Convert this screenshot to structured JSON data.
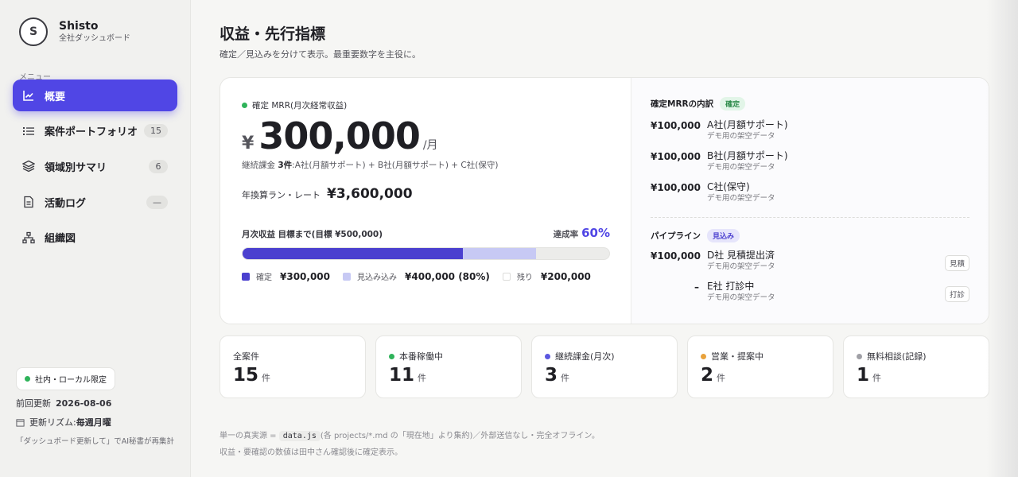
{
  "brand": {
    "name": "Shisto",
    "subtitle": "全社ダッシュボード",
    "logo_glyph": "S"
  },
  "sidebar": {
    "menu_label": "メニュー",
    "items": [
      {
        "label": "概要",
        "badge": "",
        "icon": "chart-line-icon",
        "active": true
      },
      {
        "label": "案件ポートフォリオ",
        "badge": "15",
        "icon": "list-icon"
      },
      {
        "label": "領域別サマリ",
        "badge": "6",
        "icon": "layers-icon"
      },
      {
        "label": "活動ログ",
        "badge": "—",
        "icon": "document-icon"
      },
      {
        "label": "組織図",
        "badge": "",
        "icon": "org-chart-icon"
      }
    ],
    "local_chip": "社内・ローカル限定",
    "last_updated_label": "前回更新",
    "last_updated_value": "2026-08-06",
    "rhythm_label": "更新リズム:",
    "rhythm_value": "毎週月曜",
    "note": "「ダッシュボード更新して」でAI秘書が再集計"
  },
  "header": {
    "title": "収益・先行指標",
    "subtitle": "確定／見込みを分けて表示。最重要数字を主役に。"
  },
  "mrr": {
    "label": "確定 MRR(月次経常収益)",
    "currency": "¥",
    "value": "300,000",
    "unit": "/月",
    "desc_prefix": "継続課金 ",
    "desc_count": "3件",
    "desc_suffix": ":A社(月額サポート) + B社(月額サポート) + C社(保守)",
    "runrate_label": "年換算ラン・レート",
    "runrate_value": "¥3,600,000",
    "goal_label": "月次収益 目標まで(目標 ¥500,000)",
    "achv_label": "達成率",
    "achv_value": "60%",
    "progress": {
      "confirmed_pct": 60,
      "pending_pct": 80
    },
    "legend": [
      {
        "label": "確定",
        "value": "¥300,000",
        "color": "#4b40cf"
      },
      {
        "label": "見込み込み",
        "value": "¥400,000 (80%)",
        "color": "#c7c9f4"
      },
      {
        "label": "残り",
        "value": "¥200,000",
        "color": "#ffffff"
      }
    ]
  },
  "breakdown": {
    "title": "確定MRRの内訳",
    "tag": "確定",
    "items": [
      {
        "amount": "¥100,000",
        "name": "A社(月額サポート)",
        "sub": "デモ用の架空データ"
      },
      {
        "amount": "¥100,000",
        "name": "B社(月額サポート)",
        "sub": "デモ用の架空データ"
      },
      {
        "amount": "¥100,000",
        "name": "C社(保守)",
        "sub": "デモ用の架空データ"
      }
    ]
  },
  "pipeline": {
    "title": "パイプライン",
    "tag": "見込み",
    "items": [
      {
        "amount": "¥100,000",
        "name": "D社 見積提出済",
        "sub": "デモ用の架空データ",
        "chip": "見積"
      },
      {
        "amount": "–",
        "name": "E社 打診中",
        "sub": "デモ用の架空データ",
        "chip": "打診"
      }
    ]
  },
  "stats": [
    {
      "label": "全案件",
      "value": "15",
      "unit": "件",
      "dot": ""
    },
    {
      "label": "本番稼働中",
      "value": "11",
      "unit": "件",
      "dot": "#2fb35a"
    },
    {
      "label": "継続課金(月次)",
      "value": "3",
      "unit": "件",
      "dot": "#5b57e0"
    },
    {
      "label": "営業・提案中",
      "value": "2",
      "unit": "件",
      "dot": "#e9a23b"
    },
    {
      "label": "無料相談(記録)",
      "value": "1",
      "unit": "件",
      "dot": "#a0a0a6"
    }
  ],
  "footer": {
    "line1_prefix": "単一の真実源 = ",
    "line1_code": "data.js",
    "line1_suffix": "(各 projects/*.md の「現在地」より集約)／外部送信なし・完全オフライン。",
    "line2": "収益・要確認の数値は田中さん確認後に確定表示。"
  },
  "colors": {
    "accent": "#5046e5",
    "green": "#2fb35a"
  }
}
